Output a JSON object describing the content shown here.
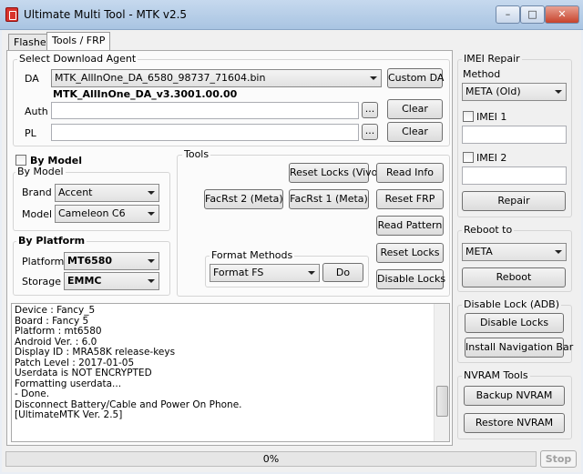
{
  "window": {
    "title": "Ultimate Multi Tool - MTK v2.5",
    "minimize_glyph": "–",
    "maximize_glyph": "□",
    "close_glyph": "✕"
  },
  "tabs": [
    {
      "label": "Flasher",
      "active": false
    },
    {
      "label": "Tools / FRP",
      "active": true
    }
  ],
  "download_agent": {
    "group_label": "Select Download Agent",
    "da_label": "DA",
    "da_value": "MTK_AllInOne_DA_6580_98737_71604.bin",
    "da_version": "MTK_AllInOne_DA_v3.3001.00.00",
    "custom_da_button": "Custom DA",
    "auth_label": "Auth",
    "auth_value": "",
    "auth_browse": "...",
    "auth_clear": "Clear",
    "pl_label": "PL",
    "pl_value": "",
    "pl_browse": "...",
    "pl_clear": "Clear"
  },
  "by_model": {
    "checkbox_label": "By Model",
    "checked": false,
    "group_label": "By Model",
    "brand_label": "Brand",
    "brand_value": "Accent",
    "model_label": "Model",
    "model_value": "Cameleon C6"
  },
  "by_platform": {
    "group_label": "By Platform",
    "platform_label": "Platform",
    "platform_value": "MT6580",
    "storage_label": "Storage",
    "storage_value": "EMMC"
  },
  "tools": {
    "group_label": "Tools",
    "reset_locks_vivo": "Reset Locks (Vivo)",
    "read_info": "Read Info",
    "facrst2_meta": "FacRst 2 (Meta)",
    "facrst1_meta": "FacRst 1 (Meta)",
    "reset_frp": "Reset FRP",
    "read_pattern": "Read Pattern",
    "format_methods_label": "Format Methods",
    "format_value": "Format FS",
    "do_button": "Do",
    "reset_locks": "Reset Locks",
    "disable_locks": "Disable Locks"
  },
  "log_lines": [
    "Device : Fancy_5",
    "Board : Fancy 5",
    "Platform : mt6580",
    "Android Ver. : 6.0",
    "Display ID : MRA58K release-keys",
    "Patch Level : 2017-01-05",
    "Userdata is NOT ENCRYPTED",
    "Formatting userdata...",
    "- Done.",
    "Disconnect Battery/Cable and Power On Phone.",
    "[UltimateMTK Ver. 2.5]"
  ],
  "imei_repair": {
    "group_label": "IMEI Repair",
    "method_label": "Method",
    "method_value": "META (Old)",
    "imei1_label": "IMEI 1",
    "imei1_value": "",
    "imei2_label": "IMEI 2",
    "imei2_value": "",
    "repair_button": "Repair"
  },
  "reboot": {
    "group_label": "Reboot to",
    "value": "META",
    "button": "Reboot"
  },
  "disable_lock_adb": {
    "group_label": "Disable Lock (ADB)",
    "disable_locks": "Disable Locks",
    "install_nav_bar": "Install Navigation Bar"
  },
  "nvram_tools": {
    "group_label": "NVRAM Tools",
    "backup": "Backup NVRAM",
    "restore": "Restore NVRAM"
  },
  "status": {
    "progress_text": "0%",
    "progress_fraction": 0,
    "stop_button": "Stop"
  }
}
